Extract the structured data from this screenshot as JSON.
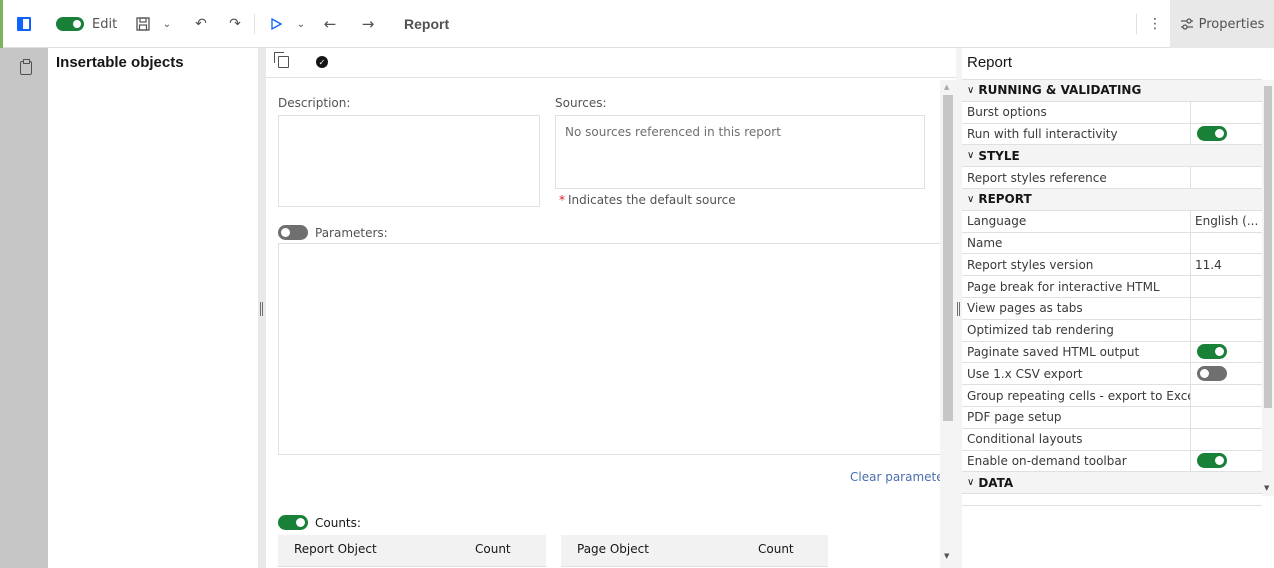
{
  "toolbar": {
    "edit_label": "Edit",
    "title": "Report",
    "properties_label": "Properties"
  },
  "insertable": {
    "header": "Insertable objects"
  },
  "center": {
    "description_label": "Description:",
    "sources_label": "Sources:",
    "sources_placeholder": "No sources referenced in this report",
    "default_note_star": "*",
    "default_note": "Indicates the default source",
    "parameters_label": "Parameters:",
    "clear_parameters": "Clear parameters",
    "counts_label": "Counts:",
    "report_table": {
      "col1": "Report Object",
      "col2": "Count"
    },
    "page_table": {
      "col1": "Page Object",
      "col2": "Count"
    },
    "parameters_enabled": false,
    "counts_enabled": true
  },
  "properties": {
    "title": "Report",
    "rows": [
      {
        "kind": "group",
        "label": "RUNNING & VALIDATING"
      },
      {
        "kind": "prop",
        "label": "Burst options",
        "value": ""
      },
      {
        "kind": "prop",
        "label": "Run with full interactivity",
        "toggle": true
      },
      {
        "kind": "group",
        "label": "STYLE"
      },
      {
        "kind": "prop",
        "label": "Report styles reference",
        "value": ""
      },
      {
        "kind": "group",
        "label": "REPORT"
      },
      {
        "kind": "prop",
        "label": "Language",
        "value": "English (..."
      },
      {
        "kind": "prop",
        "label": "Name",
        "value": ""
      },
      {
        "kind": "prop",
        "label": "Report styles version",
        "value": "11.4"
      },
      {
        "kind": "prop",
        "label": "Page break for interactive HTML",
        "value": ""
      },
      {
        "kind": "prop",
        "label": "View pages as tabs",
        "value": ""
      },
      {
        "kind": "prop",
        "label": "Optimized tab rendering",
        "value": ""
      },
      {
        "kind": "prop",
        "label": "Paginate saved HTML output",
        "toggle": true
      },
      {
        "kind": "prop",
        "label": "Use 1.x CSV export",
        "toggle": false
      },
      {
        "kind": "prop",
        "label": "Group repeating cells - export to Excel",
        "value": ""
      },
      {
        "kind": "prop",
        "label": "PDF page setup",
        "value": ""
      },
      {
        "kind": "prop",
        "label": "Conditional layouts",
        "value": ""
      },
      {
        "kind": "prop",
        "label": "Enable on-demand toolbar",
        "toggle": true
      },
      {
        "kind": "group",
        "label": "DATA"
      }
    ]
  },
  "colors": {
    "accent_green": "#198038",
    "toggle_off": "#6f6f6f",
    "rail": "#c6c6c6",
    "link": "#4a6faf",
    "run_blue": "#0f62fe"
  },
  "icons": {
    "panel": "panel-toggle-icon",
    "save": "save-icon",
    "undo": "undo-icon",
    "redo": "redo-icon",
    "run": "run-icon",
    "back": "back-arrow-icon",
    "forward": "forward-arrow-icon",
    "more": "overflow-menu-icon",
    "properties": "sliders-icon",
    "clipboard": "clipboard-icon",
    "copy": "copy-icon",
    "check": "checkmark-icon"
  }
}
